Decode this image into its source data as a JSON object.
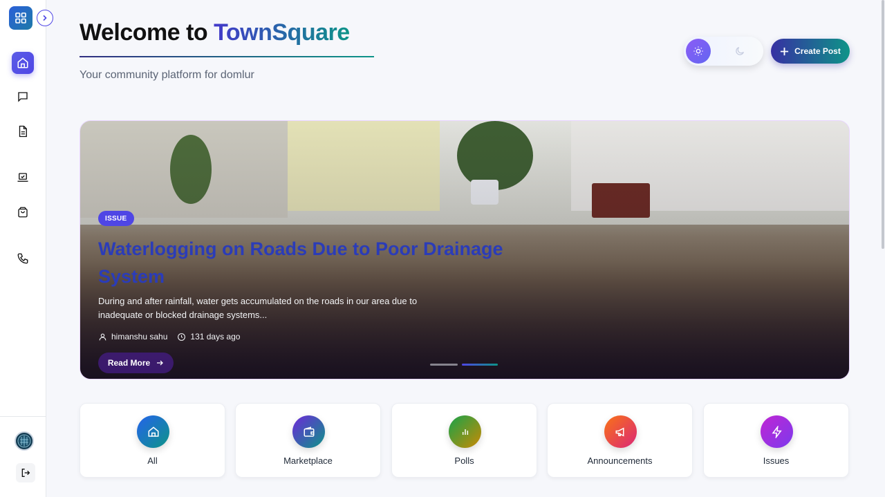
{
  "header": {
    "title_prefix": "Welcome to ",
    "title_brand": "TownSquare",
    "subtitle": "Your community platform for domlur"
  },
  "actions": {
    "create_post_label": "Create Post",
    "theme_toggle_state": "light"
  },
  "sidebar": {
    "items": [
      {
        "name": "home",
        "icon": "home-icon",
        "active": true
      },
      {
        "name": "chat",
        "icon": "message-icon",
        "active": false
      },
      {
        "name": "documents",
        "icon": "document-icon",
        "active": false
      },
      {
        "name": "polls",
        "icon": "laptop-check-icon",
        "active": false
      },
      {
        "name": "marketplace",
        "icon": "shopping-bag-icon",
        "active": false
      },
      {
        "name": "contacts",
        "icon": "phone-icon",
        "active": false
      }
    ]
  },
  "hero": {
    "badge": "ISSUE",
    "title": "Waterlogging on Roads Due to Poor Drainage System",
    "description": "During and after rainfall, water gets accumulated on the roads in our area due to inadequate or blocked drainage systems...",
    "author": "himanshu sahu",
    "time_ago": "131 days ago",
    "read_more_label": "Read More",
    "slide_count": 2,
    "active_slide": 2
  },
  "categories": [
    {
      "label": "All",
      "icon": "home-icon",
      "color_from": "#2563eb",
      "color_to": "#0d9488"
    },
    {
      "label": "Marketplace",
      "icon": "wallet-icon",
      "color_from": "#6d28d9",
      "color_to": "#0d9488"
    },
    {
      "label": "Polls",
      "icon": "bar-chart-icon",
      "color_from": "#16a34a",
      "color_to": "#ca8a04"
    },
    {
      "label": "Announcements",
      "icon": "megaphone-icon",
      "color_from": "#f97316",
      "color_to": "#db2777"
    },
    {
      "label": "Issues",
      "icon": "lightning-icon",
      "color_from": "#c026d3",
      "color_to": "#7c3aed"
    }
  ],
  "colors": {
    "accent": "#4f46e5",
    "brand_gradient_start": "#4338ca",
    "brand_gradient_end": "#0d9488"
  }
}
